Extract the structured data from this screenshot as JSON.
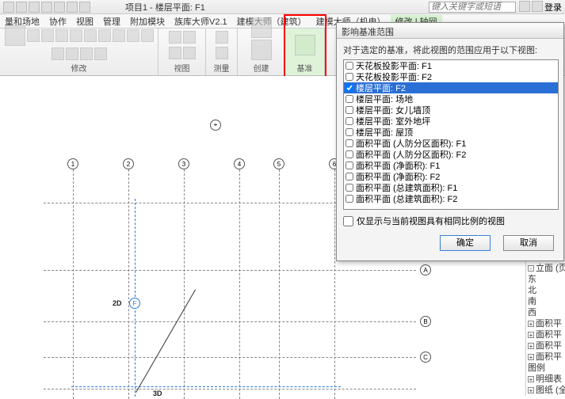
{
  "titlebar": {
    "doc": "项目1 - 楼层平面: F1",
    "search_placeholder": "键入关键字或短语",
    "login": "登录"
  },
  "menubar": {
    "items": [
      "量和场地",
      "协作",
      "视图",
      "管理",
      "附加模块",
      "族库大师V2.1",
      "建模大师（建筑）",
      "建模大师（机电）",
      "修改 | 轴网"
    ],
    "active_index": 8
  },
  "ribbon": {
    "panels": [
      "修改",
      "视图",
      "测量",
      "创建",
      "基准"
    ],
    "highlight_panel": "影响\n基准"
  },
  "dialog": {
    "title": "影响基准范围",
    "message": "对于选定的基准，将此视图的范围应用于以下视图:",
    "items": [
      {
        "label": "天花板投影平面: F1",
        "checked": false
      },
      {
        "label": "天花板投影平面: F2",
        "checked": false
      },
      {
        "label": "楼层平面: F2",
        "checked": true,
        "selected": true
      },
      {
        "label": "楼层平面: 场地",
        "checked": false
      },
      {
        "label": "楼层平面: 女儿墙顶",
        "checked": false
      },
      {
        "label": "楼层平面: 室外地坪",
        "checked": false
      },
      {
        "label": "楼层平面: 屋顶",
        "checked": false
      },
      {
        "label": "面积平面 (人防分区面积): F1",
        "checked": false
      },
      {
        "label": "面积平面 (人防分区面积): F2",
        "checked": false
      },
      {
        "label": "面积平面 (净面积): F1",
        "checked": false
      },
      {
        "label": "面积平面 (净面积): F2",
        "checked": false
      },
      {
        "label": "面积平面 (总建筑面积): F1",
        "checked": false
      },
      {
        "label": "面积平面 (总建筑面积): F2",
        "checked": false
      }
    ],
    "only_same_scale": "仅显示与当前视图具有相同比例的视图",
    "ok": "确定",
    "cancel": "取消"
  },
  "tree": {
    "items": [
      "立面 (页",
      "  东",
      "  北",
      "  南",
      "  西",
      "面积平",
      "面积平",
      "面积平",
      "面积平",
      "图例",
      "明细表",
      "图纸 (全"
    ]
  },
  "canvas": {
    "col_bubbles": [
      "1",
      "2",
      "3",
      "4",
      "5",
      "6"
    ],
    "row_bubbles": [
      "A",
      "B",
      "C"
    ],
    "anno_2d": "2D",
    "anno_3d": "3D"
  }
}
